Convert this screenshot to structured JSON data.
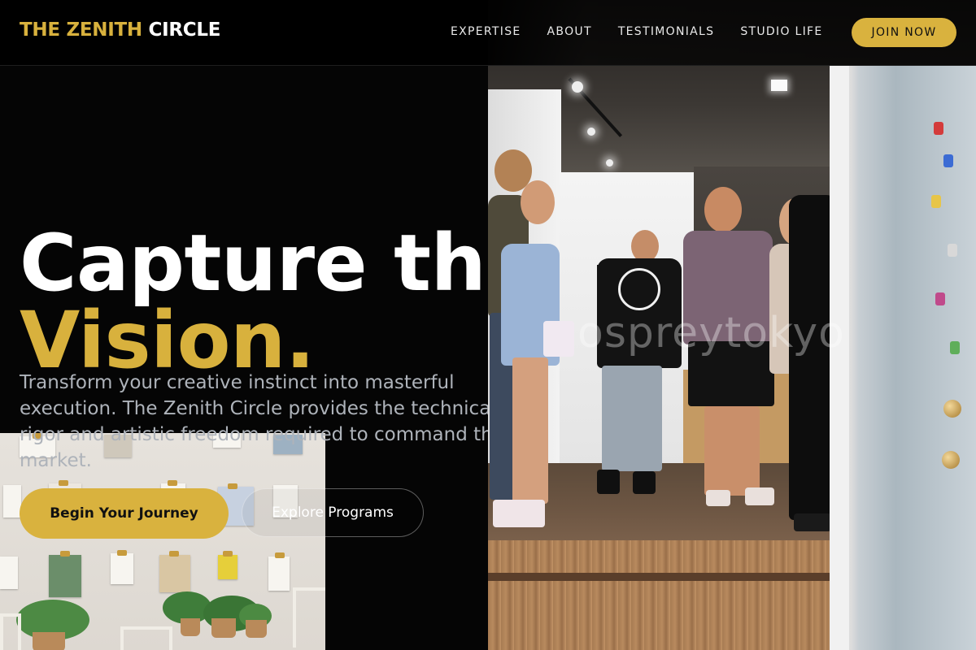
{
  "brand": {
    "name_part1": "THE ZENITH",
    "name_part2": "CIRCLE",
    "accent_color": "#d8b13d"
  },
  "nav": {
    "links": [
      {
        "label": "EXPERTISE"
      },
      {
        "label": "ABOUT"
      },
      {
        "label": "TESTIMONIALS"
      },
      {
        "label": "STUDIO LIFE"
      }
    ],
    "cta_label": "JOIN NOW"
  },
  "hero": {
    "headline_line1": "Capture th",
    "headline_line2": "Vision.",
    "subheadline": "Transform your creative instinct into masterful execution. The Zenith Circle provides the technical rigor and artistic freedom required to command the market.",
    "primary_cta": "Begin Your Journey",
    "secondary_cta": "Explore Programs"
  },
  "images": {
    "hero_photo": {
      "watermark": "ospreytokyo"
    }
  },
  "colors": {
    "background": "#050505",
    "accent": "#d9b23e",
    "subtext": "#aeb3ba"
  }
}
